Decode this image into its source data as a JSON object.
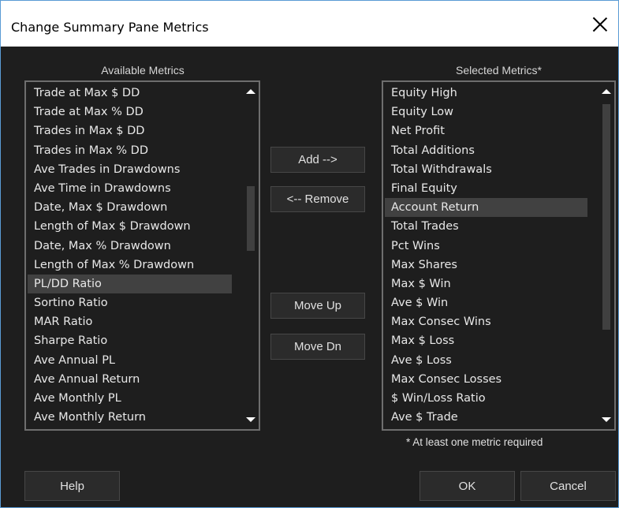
{
  "window": {
    "title": "Change Summary Pane Metrics"
  },
  "available": {
    "heading": "Available Metrics",
    "items": [
      "Trade at Max $ DD",
      "Trade at Max % DD",
      "Trades in Max $ DD",
      "Trades in Max % DD",
      "Ave Trades in Drawdowns",
      "Ave Time in Drawdowns",
      "Date, Max $ Drawdown",
      "Length of Max $ Drawdown",
      "Date, Max % Drawdown",
      "Length of Max % Drawdown",
      "PL/DD Ratio",
      "Sortino Ratio",
      "MAR Ratio",
      "Sharpe Ratio",
      "Ave Annual PL",
      "Ave Annual Return",
      "Ave Monthly PL",
      "Ave Monthly Return"
    ],
    "selected_item": "PL/DD Ratio"
  },
  "selected": {
    "heading": "Selected Metrics*",
    "items": [
      "Equity High",
      "Equity Low",
      "Net Profit",
      "Total Additions",
      "Total Withdrawals",
      "Final Equity",
      "Account Return",
      "Total Trades",
      "Pct Wins",
      "Max Shares",
      "Max $ Win",
      "Ave $ Win",
      "Max Consec Wins",
      "Max $ Loss",
      "Ave $ Loss",
      "Max Consec Losses",
      "$ Win/Loss Ratio",
      "Ave $ Trade"
    ],
    "selected_item": "Account Return",
    "footnote": "* At least one metric required"
  },
  "buttons": {
    "add": "Add -->",
    "remove": "<-- Remove",
    "move_up": "Move Up",
    "move_dn": "Move Dn",
    "help": "Help",
    "ok": "OK",
    "cancel": "Cancel"
  },
  "colors": {
    "background": "#1e1e1e",
    "selection": "#414141",
    "titlebar": "#ffffff"
  }
}
